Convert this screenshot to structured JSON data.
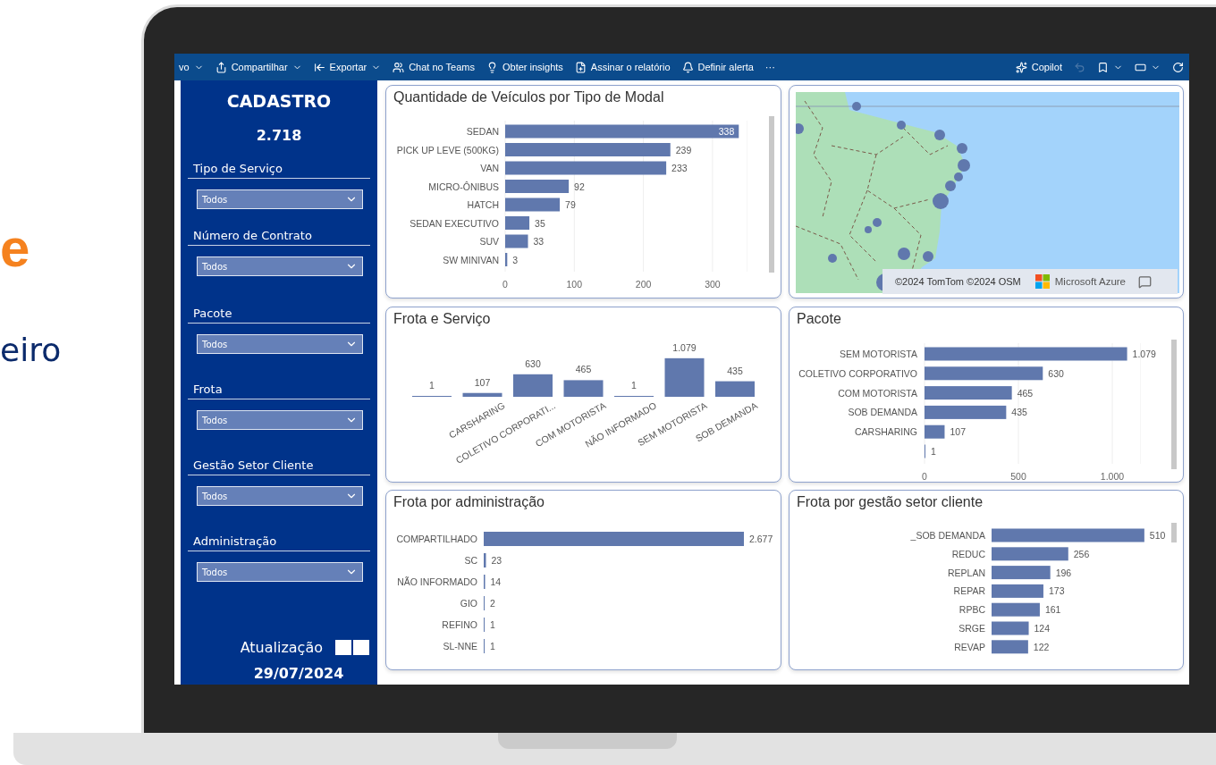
{
  "left_text": {
    "heading_fragment": "e",
    "subtitle_fragment": "eiro"
  },
  "toolbar": {
    "items": [
      {
        "label": "vo"
      },
      {
        "label": "Compartilhar"
      },
      {
        "label": "Exportar"
      },
      {
        "label": "Chat no Teams"
      },
      {
        "label": "Obter insights"
      },
      {
        "label": "Assinar o relatório"
      },
      {
        "label": "Definir alerta"
      }
    ],
    "more": "···",
    "copilot": "Copilot",
    "right_tools": [
      {
        "disabled": true
      },
      {
        "disabled": false
      },
      {
        "disabled": false
      },
      {
        "disabled": false
      }
    ]
  },
  "sidebar": {
    "title": "CADASTRO",
    "total": "2.718",
    "filters": [
      {
        "label": "Tipo de Serviço",
        "value": "Todos"
      },
      {
        "label": "Número de Contrato",
        "value": "Todos"
      },
      {
        "label": "Pacote",
        "value": "Todos"
      },
      {
        "label": "Frota",
        "value": "Todos"
      },
      {
        "label": "Gestão Setor Cliente",
        "value": "Todos"
      },
      {
        "label": "Administração",
        "value": "Todos"
      }
    ],
    "update_label": "Atualização",
    "update_date": "29/07/2024"
  },
  "cards": [
    {
      "kind": "chart",
      "title": "Quantidade de Veículos por Tipo de Modal",
      "chart_data": {
        "type": "bar",
        "orientation": "horizontal",
        "categories": [
          "SEDAN",
          "PICK UP LEVE (500KG)",
          "VAN",
          "MICRO-ÔNIBUS",
          "HATCH",
          "SEDAN EXECUTIVO",
          "SUV",
          "SW MINIVAN"
        ],
        "values": [
          338,
          239,
          233,
          92,
          79,
          35,
          33,
          3
        ],
        "value_labels": [
          "338",
          "239",
          "233",
          "92",
          "79",
          "35",
          "33",
          "3"
        ],
        "xticks": [
          0,
          100,
          200,
          300
        ],
        "xlim": [
          0,
          350
        ],
        "grid": true
      }
    },
    {
      "kind": "map",
      "attribution": "©2024 TomTom ©2024 OSM",
      "provider": "Microsoft Azure"
    },
    {
      "kind": "chart",
      "title": "Frota e Serviço",
      "chart_data": {
        "type": "bar",
        "orientation": "vertical",
        "categories": [
          null,
          "CARSHARING",
          "COLETIVO CORPORATI...",
          "COM MOTORISTA",
          "NÃO INFORMADO",
          "SEM MOTORISTA",
          "SOB DEMANDA"
        ],
        "values": [
          1,
          107,
          630,
          465,
          1,
          1079,
          435
        ],
        "value_labels": [
          "1",
          "107",
          "630",
          "465",
          "1",
          "1.079",
          "435"
        ]
      }
    },
    {
      "kind": "chart",
      "title": "Pacote",
      "chart_data": {
        "type": "bar",
        "orientation": "horizontal",
        "categories": [
          "SEM MOTORISTA",
          "COLETIVO CORPORATIVO",
          "COM MOTORISTA",
          "SOB DEMANDA",
          "CARSHARING",
          null
        ],
        "values": [
          1079,
          630,
          465,
          435,
          107,
          1
        ],
        "value_labels": [
          "1.079",
          "630",
          "465",
          "435",
          "107",
          "1"
        ],
        "xticks": [
          0,
          500,
          {
            "value": 1000,
            "label": "1.000"
          }
        ],
        "xlim": [
          0,
          1150
        ],
        "grid": true
      }
    },
    {
      "kind": "chart",
      "title": "Frota por administração",
      "chart_data": {
        "type": "bar",
        "orientation": "horizontal",
        "categories": [
          "COMPARTILHADO",
          "SC",
          "NÃO INFORMADO",
          "GIO",
          "REFINO",
          "SL-NNE"
        ],
        "values": [
          2677,
          23,
          14,
          2,
          1,
          1
        ],
        "value_labels": [
          "2.677",
          "23",
          "14",
          "2",
          "1",
          "1"
        ]
      }
    },
    {
      "kind": "chart",
      "title": "Frota por gestão setor cliente",
      "chart_data": {
        "type": "bar",
        "orientation": "horizontal",
        "categories": [
          "_SOB DEMANDA",
          "REDUC",
          "REPLAN",
          "REPAR",
          "RPBC",
          "SRGE",
          "REVAP"
        ],
        "values": [
          510,
          256,
          196,
          173,
          161,
          124,
          122
        ],
        "value_labels": [
          "510",
          "256",
          "196",
          "173",
          "161",
          "124",
          "122"
        ]
      }
    }
  ]
}
